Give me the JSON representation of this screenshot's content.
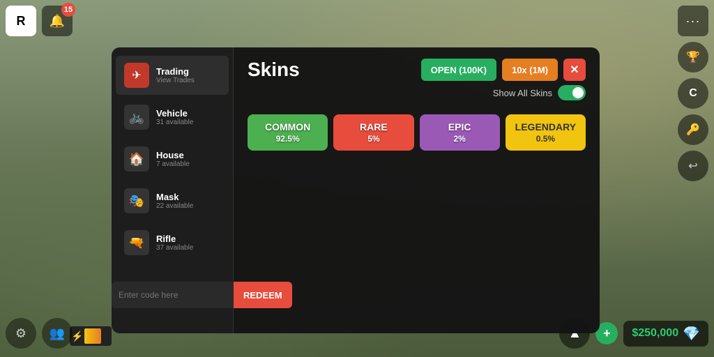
{
  "topbar": {
    "roblox_label": "R",
    "notif_count": "15",
    "ellipsis": "···"
  },
  "sidebar": {
    "items": [
      {
        "id": "trading",
        "title": "Trading",
        "sub": "View Trades",
        "icon": "✈",
        "active": true
      },
      {
        "id": "vehicle",
        "title": "Vehicle",
        "sub": "31 available",
        "icon": "🚲",
        "active": false
      },
      {
        "id": "house",
        "title": "House",
        "sub": "7 available",
        "icon": "🏠",
        "active": false
      },
      {
        "id": "mask",
        "title": "Mask",
        "sub": "22 available",
        "icon": "🎭",
        "active": false
      },
      {
        "id": "rifle",
        "title": "Rifle",
        "sub": "37 available",
        "icon": "🔫",
        "active": false
      }
    ]
  },
  "modal": {
    "title": "Skins",
    "open_btn": "OPEN (100K)",
    "open_10x_btn": "10x (1M)",
    "show_all_label": "Show All Skins",
    "close_label": "✕",
    "rarities": [
      {
        "id": "common",
        "name": "COMMON",
        "pct": "92.5%",
        "class": "rarity-common"
      },
      {
        "id": "rare",
        "name": "RARE",
        "pct": "5%",
        "class": "rarity-rare"
      },
      {
        "id": "epic",
        "name": "EPIC",
        "pct": "2%",
        "class": "rarity-epic"
      },
      {
        "id": "legendary",
        "name": "LEGENDARY",
        "pct": "0.5%",
        "class": "rarity-legendary"
      }
    ]
  },
  "code_bar": {
    "placeholder": "Enter code here",
    "redeem_btn": "REDEEM"
  },
  "bottom_right": {
    "currency": "$250,000",
    "plus": "+",
    "up": "▲"
  },
  "right_icons": [
    "🏆",
    "C",
    "🔑",
    "↩"
  ],
  "bottom_icons": [
    "⚙",
    "👥"
  ]
}
